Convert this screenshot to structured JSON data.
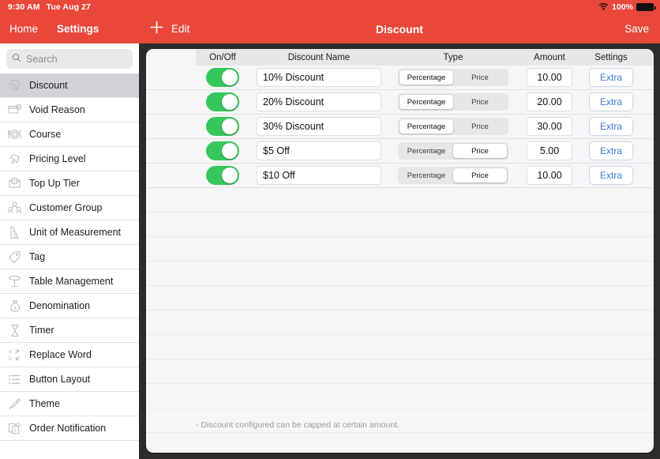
{
  "status_bar": {
    "time": "9:30 AM",
    "date": "Tue Aug 27",
    "battery_percent": "100%",
    "wifi_icon": "wifi-icon",
    "battery_icon": "battery-full-icon"
  },
  "left_nav": {
    "home_label": "Home",
    "settings_label": "Settings"
  },
  "top_bar": {
    "add_icon": "plus-icon",
    "edit_label": "Edit",
    "title": "Discount",
    "save_label": "Save"
  },
  "sidebar": {
    "search": {
      "placeholder": "Search",
      "icon": "search-icon"
    },
    "items": [
      {
        "label": "Discount",
        "icon": "discount-badge-icon",
        "active": true
      },
      {
        "label": "Void Reason",
        "icon": "void-card-icon",
        "active": false
      },
      {
        "label": "Course",
        "icon": "cutlery-plate-icon",
        "active": false
      },
      {
        "label": "Pricing Level",
        "icon": "price-tag-arrow-icon",
        "active": false
      },
      {
        "label": "Top Up Tier",
        "icon": "topup-envelope-icon",
        "active": false
      },
      {
        "label": "Customer Group",
        "icon": "customer-group-icon",
        "active": false
      },
      {
        "label": "Unit of Measurement",
        "icon": "ruler-icon",
        "active": false
      },
      {
        "label": "Tag",
        "icon": "tag-icon",
        "active": false
      },
      {
        "label": "Table Management",
        "icon": "table-icon",
        "active": false
      },
      {
        "label": "Denomination",
        "icon": "money-bag-icon",
        "active": false
      },
      {
        "label": "Timer",
        "icon": "hourglass-icon",
        "active": false
      },
      {
        "label": "Replace Word",
        "icon": "replace-word-icon",
        "active": false
      },
      {
        "label": "Button Layout",
        "icon": "list-layout-icon",
        "active": false
      },
      {
        "label": "Theme",
        "icon": "paint-brush-icon",
        "active": false
      },
      {
        "label": "Order Notification",
        "icon": "order-notification-icon",
        "active": false
      }
    ]
  },
  "main": {
    "columns": [
      "On/Off",
      "Discount Name",
      "Type",
      "Amount",
      "Settings"
    ],
    "type_options": [
      "Percentage",
      "Price"
    ],
    "settings_button_label": "Extra",
    "rows": [
      {
        "enabled": true,
        "name": "10% Discount",
        "type": "Percentage",
        "amount": "10.00",
        "settings": "Extra"
      },
      {
        "enabled": true,
        "name": "20% Discount",
        "type": "Percentage",
        "amount": "20.00",
        "settings": "Extra"
      },
      {
        "enabled": true,
        "name": "30% Discount",
        "type": "Percentage",
        "amount": "30.00",
        "settings": "Extra"
      },
      {
        "enabled": true,
        "name": "$5 Off",
        "type": "Price",
        "amount": "5.00",
        "settings": "Extra"
      },
      {
        "enabled": true,
        "name": "$10 Off",
        "type": "Price",
        "amount": "10.00",
        "settings": "Extra"
      }
    ],
    "empty_row_count": 10,
    "footnote": "- Discount configured can be capped at certain amount."
  },
  "colors": {
    "brand_red": "#e8473a",
    "toggle_green": "#35c759",
    "link_blue": "#3a7bd5",
    "bezel_dark": "#2c2c2c"
  }
}
